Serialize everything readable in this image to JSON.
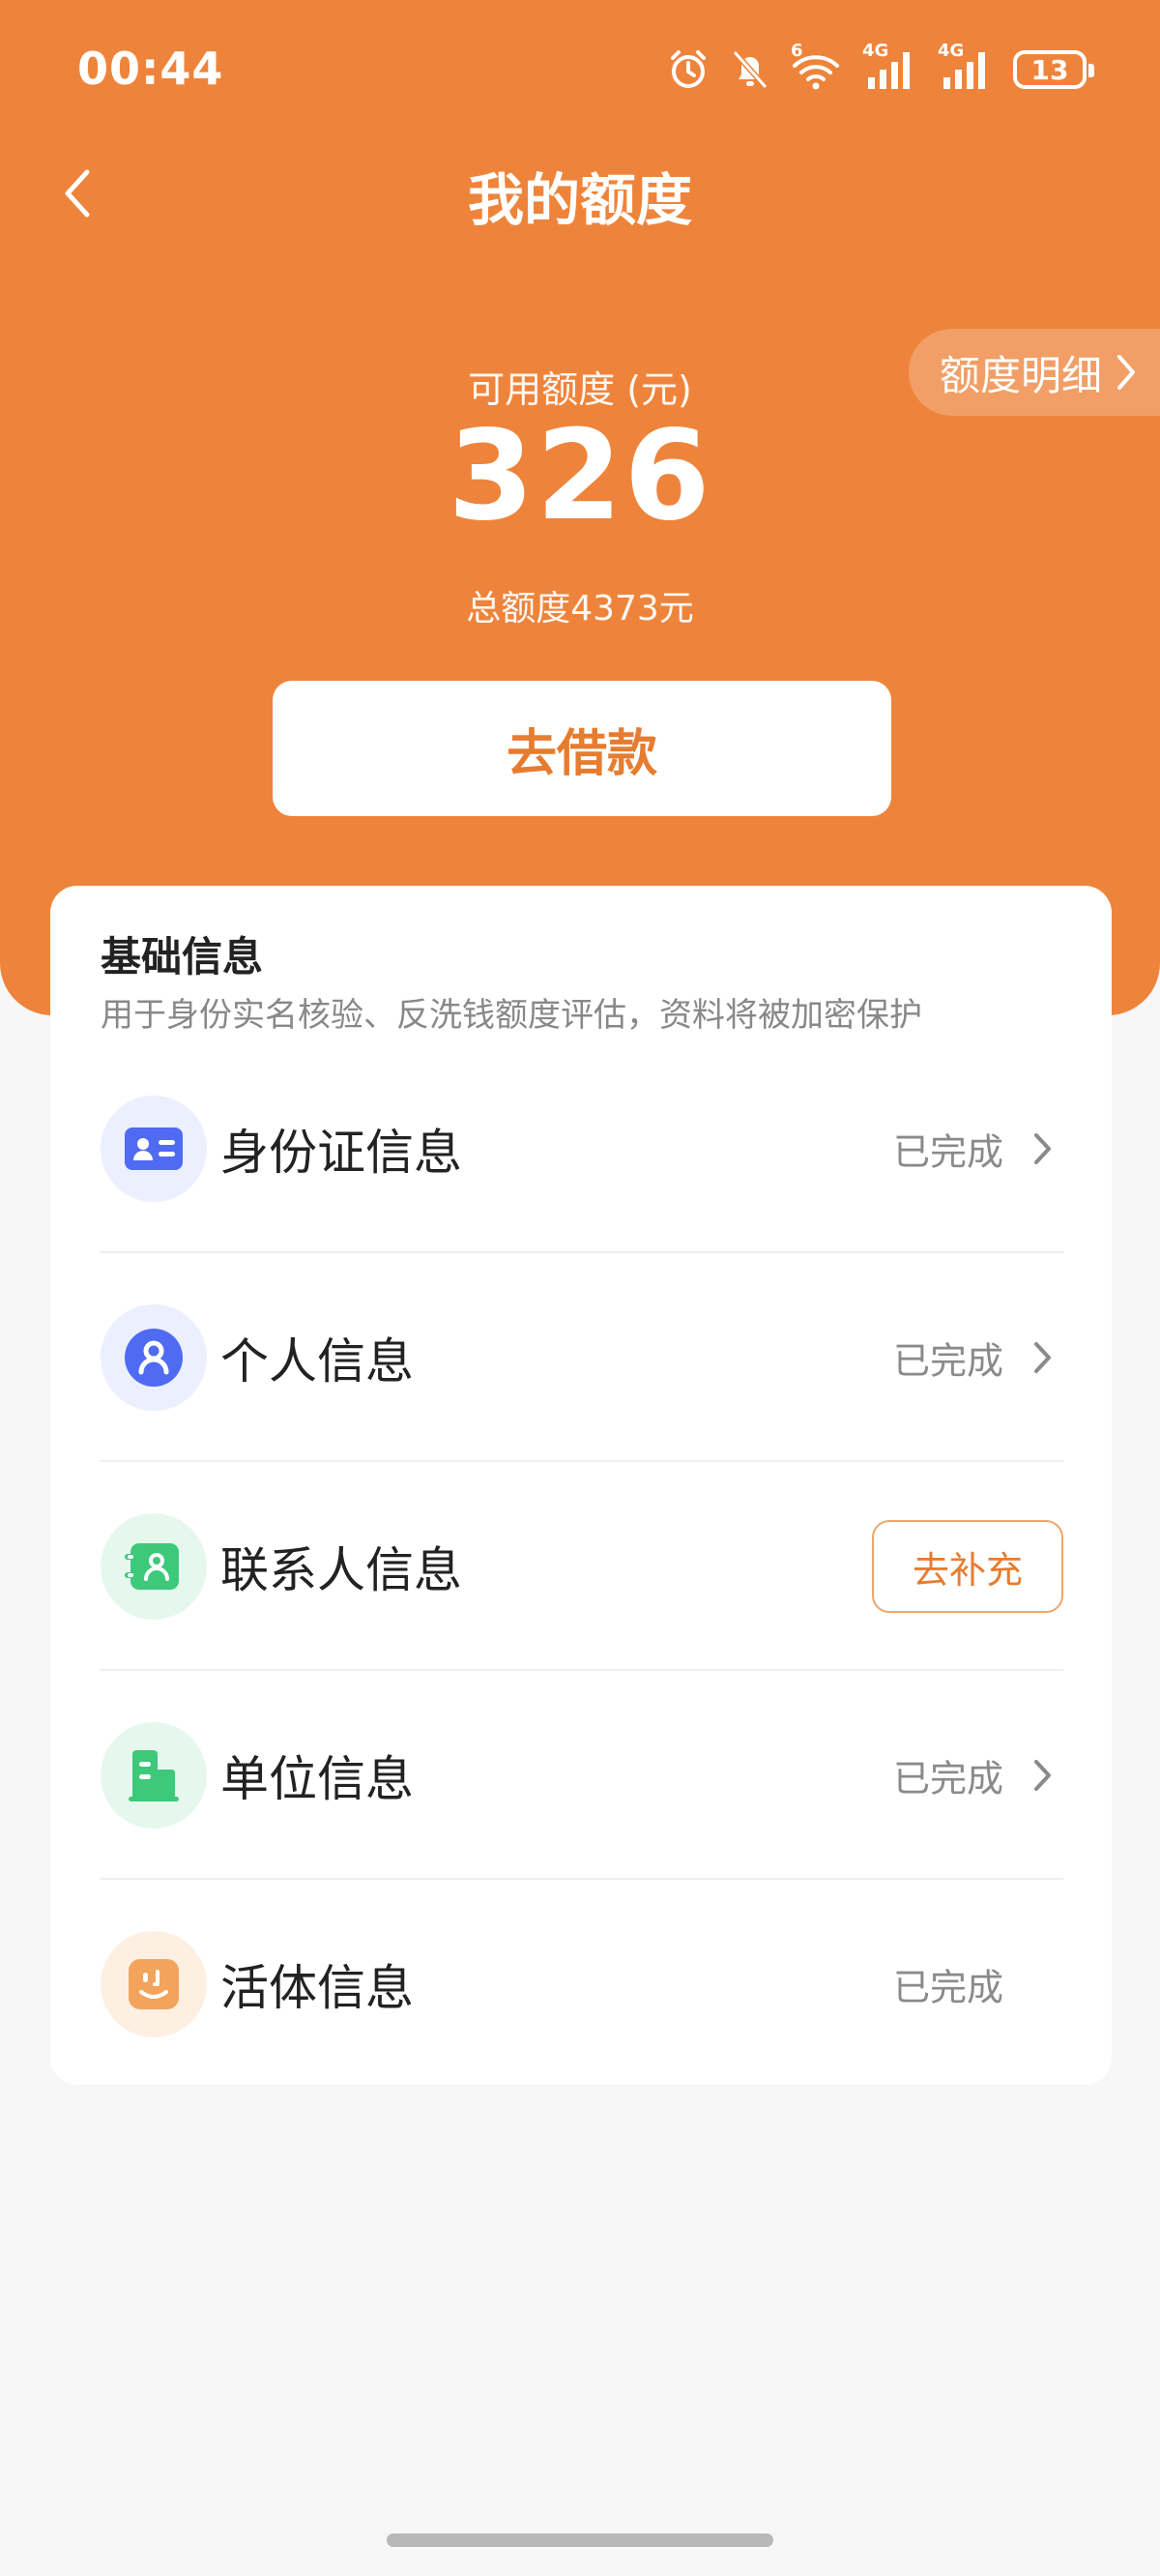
{
  "status_bar": {
    "time": "00:44",
    "battery_level": "13",
    "network_wifi_label": "6",
    "network_sim1_label": "4G",
    "network_sim2_label": "4G"
  },
  "header": {
    "title": "我的额度",
    "detail_link": "额度明细"
  },
  "quota": {
    "available_label": "可用额度 (元)",
    "available_amount": "326",
    "total_label": "总额度4373元"
  },
  "borrow_button": "去借款",
  "basic_info": {
    "title": "基础信息",
    "subtitle": "用于身份实名核验、反洗钱额度评估，资料将被加密保护",
    "items": [
      {
        "label": "身份证信息",
        "status": "已完成",
        "icon": "id-card-icon"
      },
      {
        "label": "个人信息",
        "status": "已完成",
        "icon": "person-icon"
      },
      {
        "label": "联系人信息",
        "action": "去补充",
        "icon": "contacts-icon"
      },
      {
        "label": "单位信息",
        "status": "已完成",
        "icon": "building-icon"
      },
      {
        "label": "活体信息",
        "status": "已完成",
        "icon": "face-icon"
      }
    ]
  },
  "colors": {
    "brand": "#ee843b",
    "accent_text": "#e67c30",
    "id_icon": "#4f6bf2",
    "contact_icon": "#3dc97a",
    "face_icon": "#f3a45c"
  }
}
